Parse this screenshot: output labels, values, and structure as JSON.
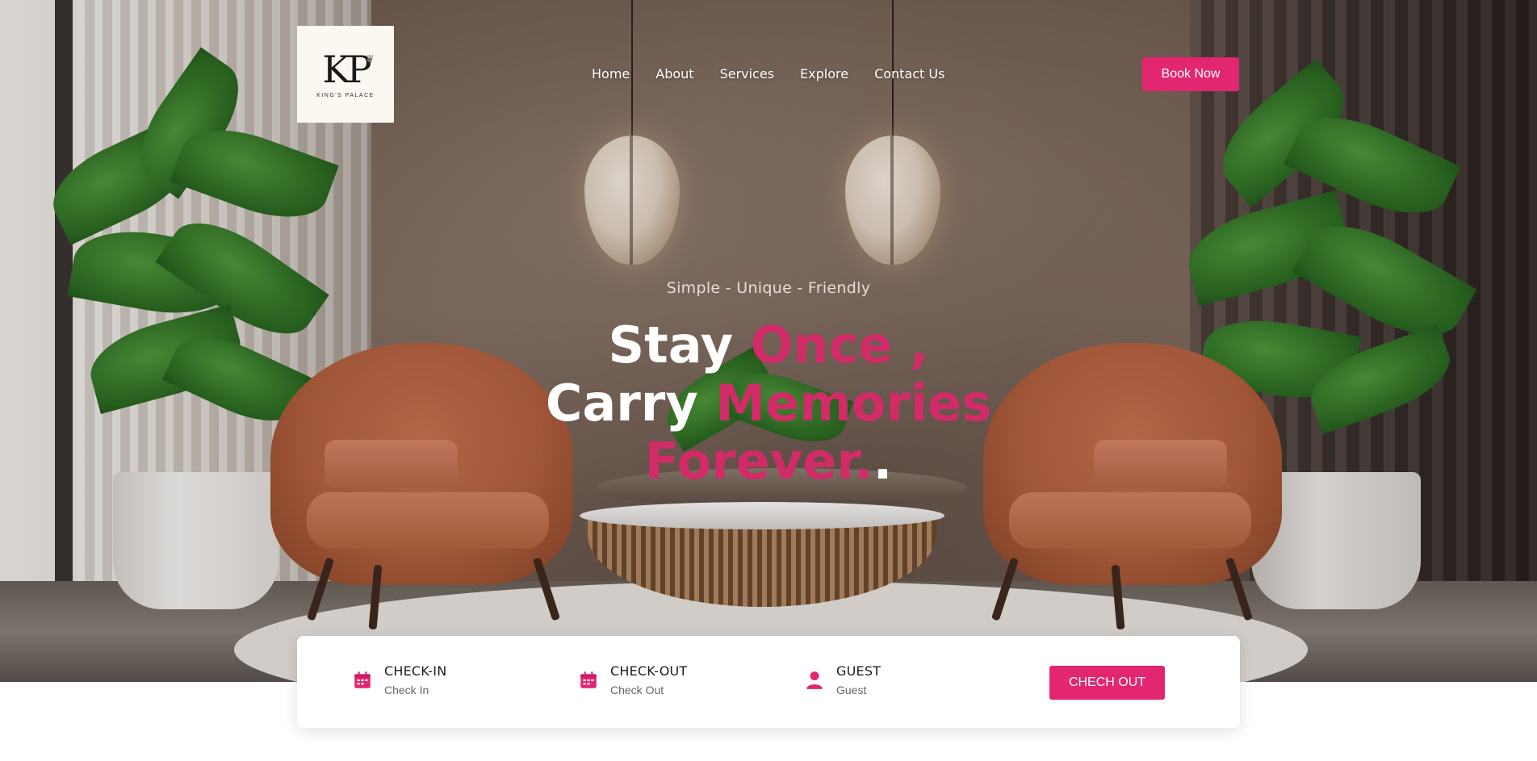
{
  "brand": {
    "monogram": "KP",
    "name": "KING'S PALACE"
  },
  "nav": {
    "items": [
      {
        "label": "Home"
      },
      {
        "label": "About"
      },
      {
        "label": "Services"
      },
      {
        "label": "Explore"
      },
      {
        "label": "Contact Us"
      }
    ],
    "cta_label": "Book Now"
  },
  "hero": {
    "tagline": "Simple - Unique - Friendly",
    "line1_white": "Stay ",
    "line1_accent": "Once ,",
    "line2_white": "Carry ",
    "line2_accent": "Memories",
    "line3_accent": "Forever.",
    "line3_white": "."
  },
  "booking": {
    "checkin": {
      "label": "CHECK-IN",
      "value": "Check In",
      "icon": "calendar-icon"
    },
    "checkout": {
      "label": "CHECK-OUT",
      "value": "Check Out",
      "icon": "calendar-icon"
    },
    "guest": {
      "label": "GUEST",
      "value": "Guest",
      "icon": "user-icon"
    },
    "submit_label": "CHECH OUT"
  },
  "colors": {
    "accent": "#e2266f",
    "headline_accent": "#d12b68",
    "text_dark": "#1c1c1c"
  }
}
